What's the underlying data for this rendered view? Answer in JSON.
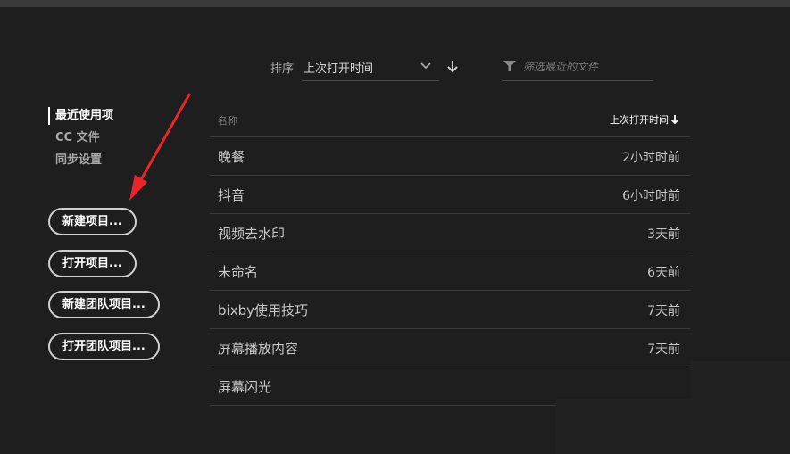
{
  "toolbar": {
    "sort_label": "排序",
    "sort_value": "上次打开时间",
    "filter_placeholder": "筛选最近的文件"
  },
  "nav": {
    "items": [
      {
        "label": "最近使用项",
        "active": true
      },
      {
        "label": "CC 文件",
        "active": false
      },
      {
        "label": "同步设置",
        "active": false
      }
    ]
  },
  "buttons": {
    "new_project": "新建项目...",
    "open_project": "打开项目...",
    "new_team_project": "新建团队项目...",
    "open_team_project": "打开团队项目..."
  },
  "list": {
    "header_name": "名称",
    "header_date": "上次打开时间",
    "rows": [
      {
        "name": "晚餐",
        "time": "2小时时前"
      },
      {
        "name": "抖音",
        "time": "6小时时前"
      },
      {
        "name": "视频去水印",
        "time": "3天前"
      },
      {
        "name": "未命名",
        "time": "6天前"
      },
      {
        "name": "bixby使用技巧",
        "time": "7天前"
      },
      {
        "name": "屏幕播放内容",
        "time": "7天前"
      },
      {
        "name": "屏幕闪光",
        "time": ""
      }
    ]
  },
  "colors": {
    "background": "#1e1e1e",
    "annotation_arrow": "#e8262a"
  }
}
